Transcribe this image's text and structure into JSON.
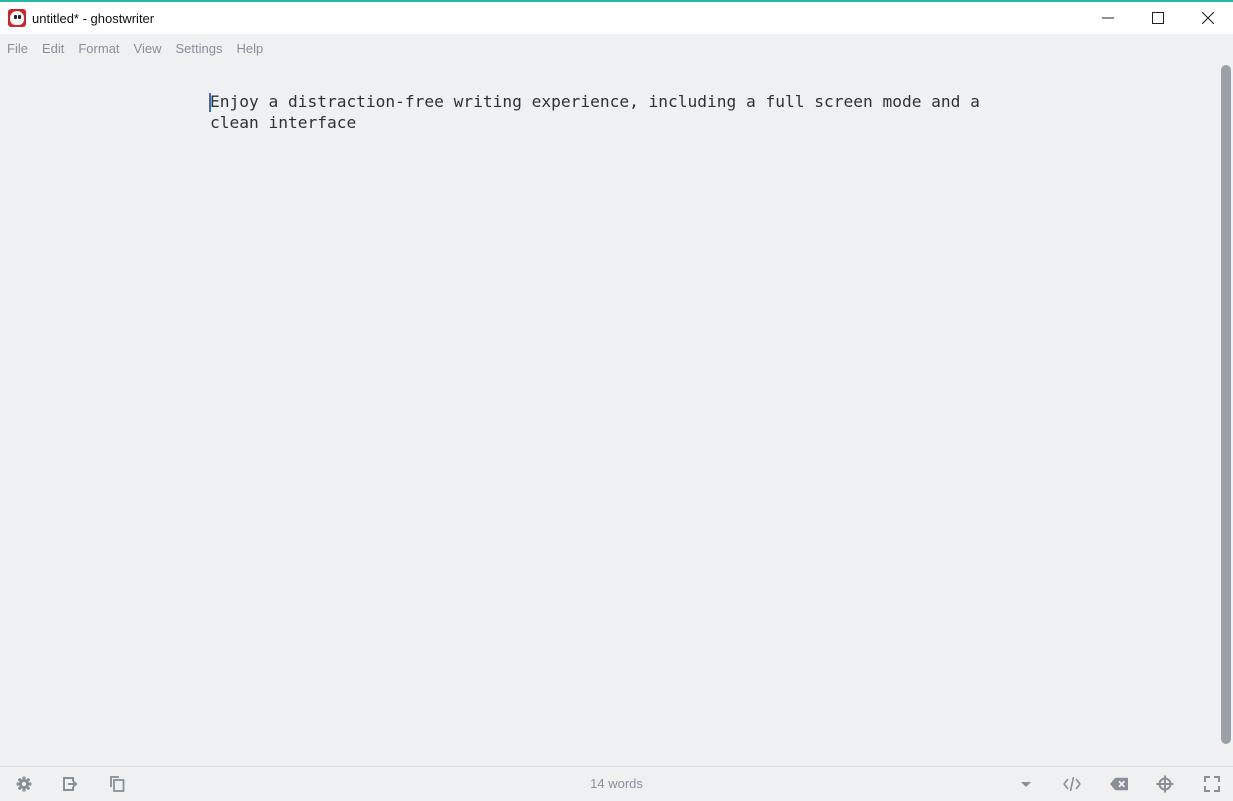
{
  "window": {
    "title": "untitled* - ghostwriter",
    "app_icon": "ghostwriter-app-icon",
    "controls": [
      "minimize-icon",
      "maximize-icon",
      "close-icon"
    ]
  },
  "menu": {
    "items": [
      {
        "label": "File"
      },
      {
        "label": "Edit"
      },
      {
        "label": "Format"
      },
      {
        "label": "View"
      },
      {
        "label": "Settings"
      },
      {
        "label": "Help"
      }
    ]
  },
  "editor": {
    "text": "Enjoy a distraction-free writing experience, including a full screen mode and a\nclean interface"
  },
  "statusbar": {
    "word_count": "14 words",
    "left_icons": [
      "settings-gear-icon",
      "export-icon",
      "copy-html-icon"
    ],
    "right_icons": [
      "dropdown-arrow-icon",
      "html-preview-icon",
      "hemingway-mode-icon",
      "focus-mode-icon",
      "fullscreen-icon"
    ]
  },
  "colors": {
    "accent": "#2ab5a0",
    "background": "#eef0f2",
    "text": "#2f3133",
    "muted": "#8a8f96"
  }
}
